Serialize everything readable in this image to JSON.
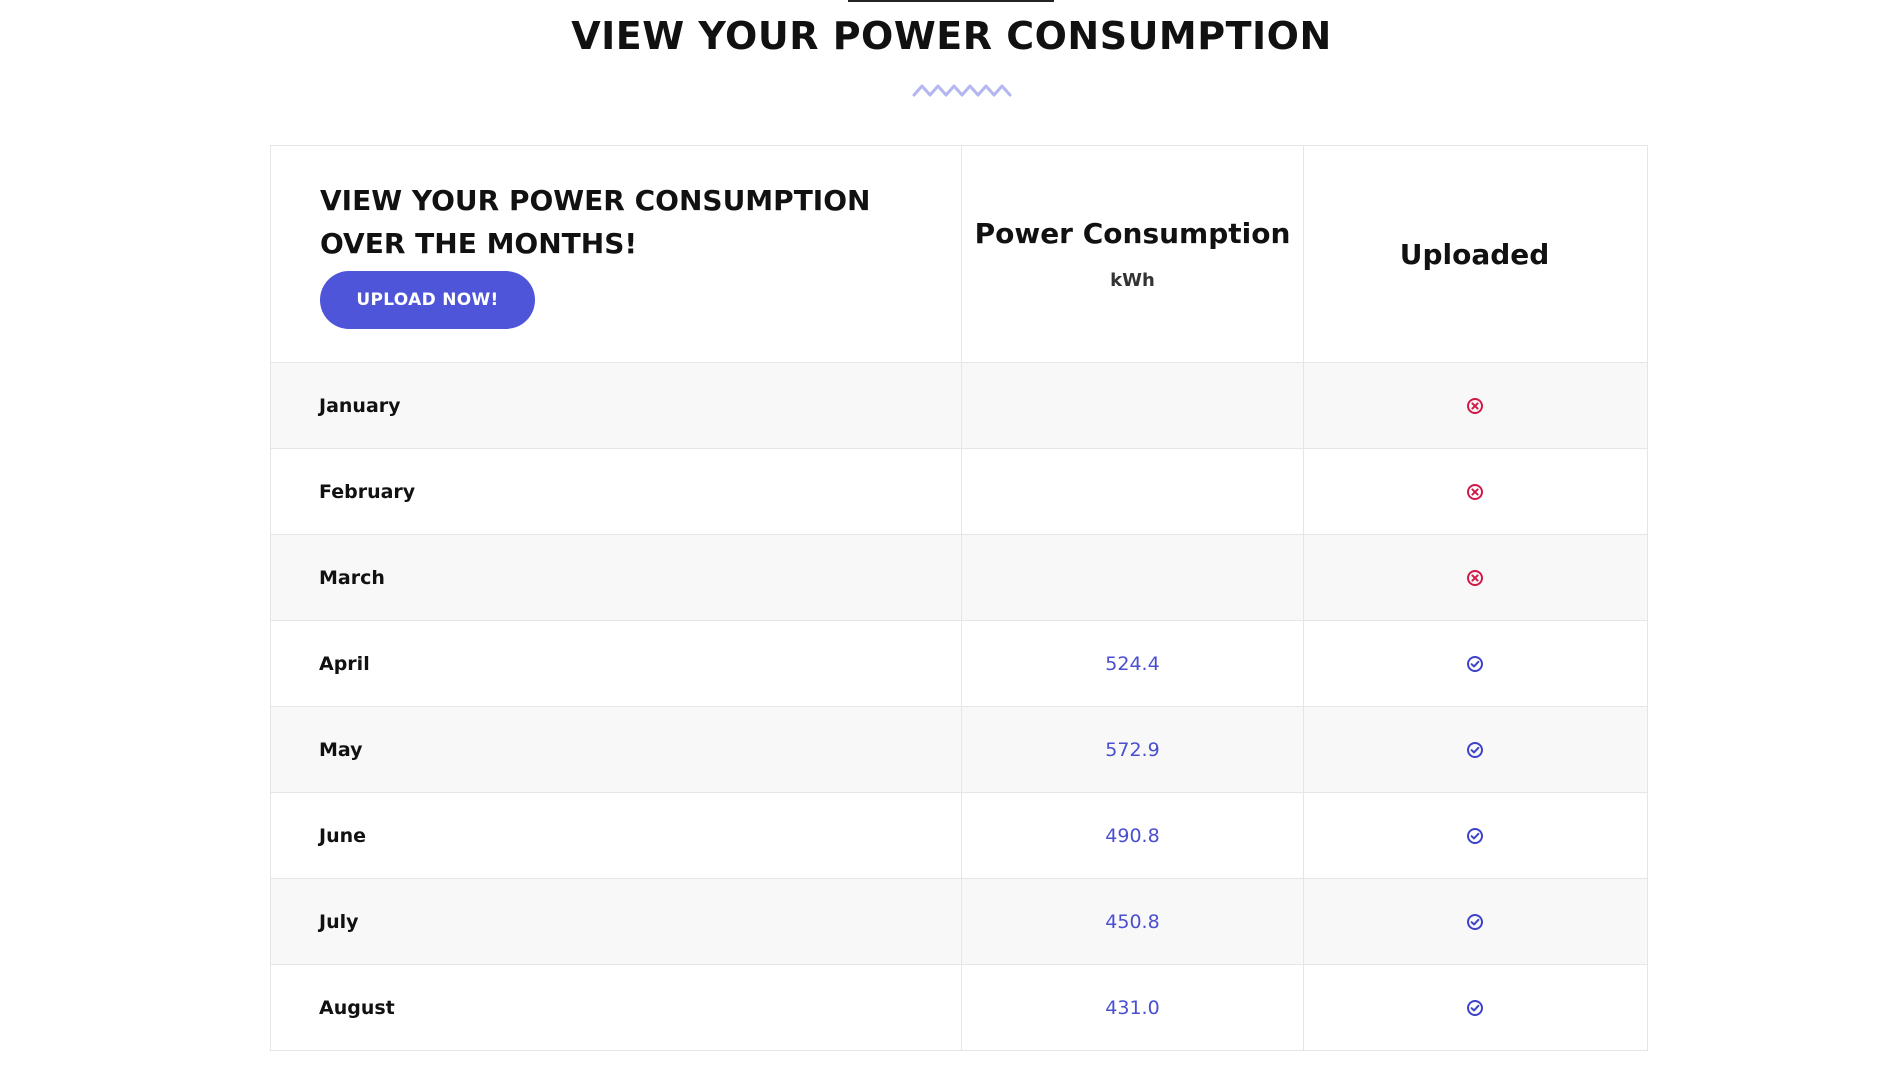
{
  "page": {
    "title": "VIEW YOUR POWER CONSUMPTION"
  },
  "table": {
    "intro_title": "VIEW YOUR POWER CONSUMPTION OVER THE MONTHS!",
    "upload_button_label": "UPLOAD NOW!",
    "column_power_title": "Power Consumption",
    "column_power_unit": "kWh",
    "column_uploaded_title": "Uploaded",
    "rows": [
      {
        "month": "January",
        "value": "",
        "uploaded": false,
        "status_icon": "x-circle-icon"
      },
      {
        "month": "February",
        "value": "",
        "uploaded": false,
        "status_icon": "x-circle-icon"
      },
      {
        "month": "March",
        "value": "",
        "uploaded": false,
        "status_icon": "x-circle-icon"
      },
      {
        "month": "April",
        "value": "524.4",
        "uploaded": true,
        "status_icon": "check-circle-icon"
      },
      {
        "month": "May",
        "value": "572.9",
        "uploaded": true,
        "status_icon": "check-circle-icon"
      },
      {
        "month": "June",
        "value": "490.8",
        "uploaded": true,
        "status_icon": "check-circle-icon"
      },
      {
        "month": "July",
        "value": "450.8",
        "uploaded": true,
        "status_icon": "check-circle-icon"
      },
      {
        "month": "August",
        "value": "431.0",
        "uploaded": true,
        "status_icon": "check-circle-icon"
      }
    ]
  },
  "colors": {
    "accent": "#4f55d8",
    "value_text": "#4a4fd0",
    "not_uploaded": "#d21a48",
    "uploaded": "#3d43c8",
    "zigzag": "#b3b6ef"
  }
}
